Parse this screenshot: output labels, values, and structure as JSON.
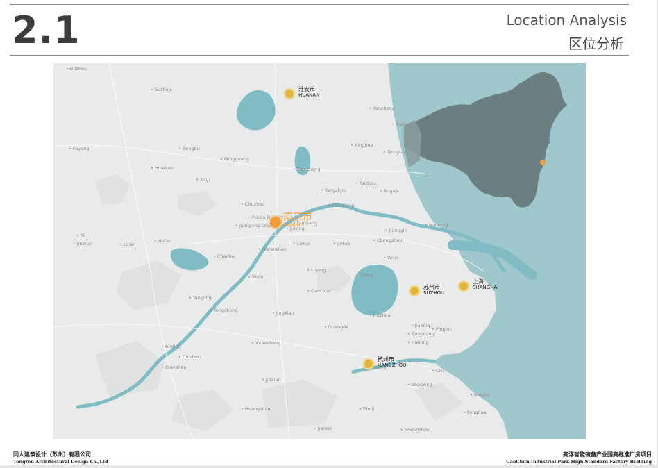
{
  "header": {
    "section_number": "2.1",
    "title_en": "Location Analysis",
    "title_cn": "区位分析"
  },
  "map": {
    "cities": [
      {
        "key": "huaian",
        "name_cn": "淮安市",
        "name_en": "HUANAN"
      },
      {
        "key": "nanjing",
        "name_cn": "南京市",
        "name_en": "NANJING"
      },
      {
        "key": "suzhou",
        "name_cn": "苏州市",
        "name_en": "SUZHOU"
      },
      {
        "key": "shanghai",
        "name_cn": "上海",
        "name_en": "SHANGHAI"
      },
      {
        "key": "hangzhou",
        "name_cn": "杭州市",
        "name_en": "HANGZHOU"
      }
    ],
    "base_labels": [
      "Bozhou",
      "Suzhou",
      "Fuyang",
      "Huainan",
      "Bengbu",
      "Mingguang",
      "Tianchang",
      "Chuzhou",
      "Xuyi",
      "Yancheng",
      "Dafeng",
      "Xinghua",
      "Dongtai",
      "Yangzhou",
      "Taizhou",
      "Rugao",
      "Zhenjiang",
      "Danyang",
      "Changzhou",
      "Jintan",
      "Nantong",
      "Wuxi",
      "Jiangyin",
      "Yixing",
      "Liyang",
      "Huzhou",
      "Jiaxing",
      "Tongxiang",
      "Haining",
      "Pinghu",
      "Wuhu",
      "Ma'anshan",
      "Chaohu",
      "Hefei",
      "Lu'an",
      "Tongling",
      "Tongcheng",
      "Anqing",
      "Xuancheng",
      "Fuyang",
      "Shaoxing",
      "Ningbo",
      "Cixi",
      "Zhuji",
      "Jiaxian",
      "Huangshan",
      "Shengzhou",
      "Fenghua",
      "Jiande",
      "Pukou District",
      "Jiangning District",
      "Jurong",
      "Lishui",
      "Gaochun",
      "Yi",
      "Jinzhai",
      "Chizhou",
      "Qianshan",
      "Jingxian",
      "Guangde"
    ],
    "colors": {
      "land": "#e9ebea",
      "sea": "#9fc8cc",
      "river": "#7fbcc4",
      "china": "#66787b",
      "highlight": "#f39a3c",
      "city_dot": "#e0b33a"
    }
  },
  "footer": {
    "left_cn": "同人建筑设计（苏州）有限公司",
    "left_en": "Tongren Architectural Design Co.,Ltd",
    "right_cn": "高淳智能装备产业园高标准厂房项目",
    "right_en": "GaoChun Industrial Park High Standard Factory Building"
  }
}
